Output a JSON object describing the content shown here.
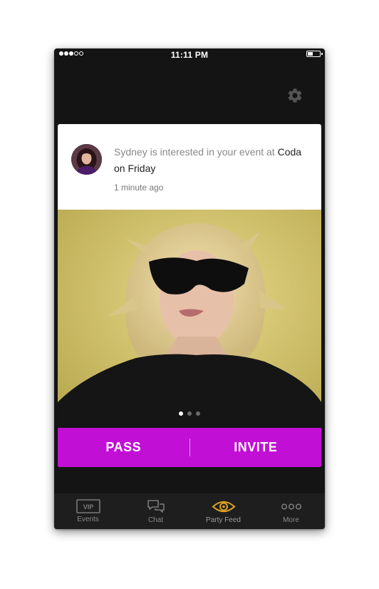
{
  "status_bar": {
    "time": "11:11 PM"
  },
  "notification": {
    "prefix": "Sydney is interested in your event at ",
    "venue": "Coda on Friday",
    "timestamp": "1 minute ago"
  },
  "carousel": {
    "pages": 3,
    "active_page": 1
  },
  "actions": {
    "pass_label": "PASS",
    "invite_label": "INVITE"
  },
  "tabs": [
    {
      "label": "Events",
      "icon": "vip-icon",
      "badge": "VIP"
    },
    {
      "label": "Chat",
      "icon": "chat-icon"
    },
    {
      "label": "Party Feed",
      "icon": "eye-icon",
      "active": true
    },
    {
      "label": "More",
      "icon": "more-icon"
    }
  ],
  "colors": {
    "accent": "#c20fd6",
    "active_tab_icon": "#e0a21c",
    "background": "#141414",
    "tab_bar": "#1e1e1e"
  }
}
